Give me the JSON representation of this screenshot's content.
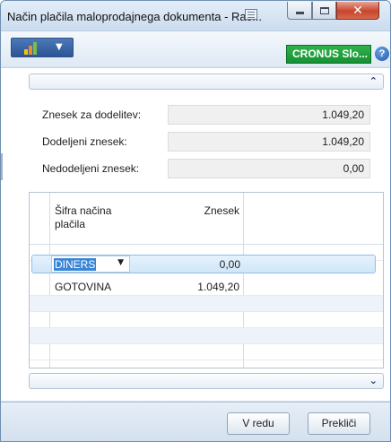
{
  "window": {
    "title": "Način plačila maloprodajnega dokumenta - Rač..."
  },
  "toolbar": {
    "company": "CRONUS Slo...",
    "help": "?"
  },
  "fasttab": {
    "collapse_icon": "chevron-up-icon",
    "expand_icon": "chevron-down-icon"
  },
  "fields": {
    "to_allocate": {
      "label": "Znesek za dodelitev:",
      "value": "1.049,20"
    },
    "allocated": {
      "label": "Dodeljeni znesek:",
      "value": "1.049,20"
    },
    "unallocated": {
      "label": "Nedodeljeni znesek:",
      "value": "0,00"
    }
  },
  "grid": {
    "columns": [
      "Šifra načina plačila",
      "Znesek"
    ],
    "rows": [
      {
        "code": "DINERS",
        "amount": "0,00",
        "selected": true
      },
      {
        "code": "GOTOVINA",
        "amount": "1.049,20",
        "selected": false
      }
    ]
  },
  "buttons": {
    "ok": "V redu",
    "cancel": "Prekliči"
  },
  "colors": {
    "company_badge": "#169136",
    "selection": "#3a85d6",
    "close_button": "#c8452c"
  }
}
